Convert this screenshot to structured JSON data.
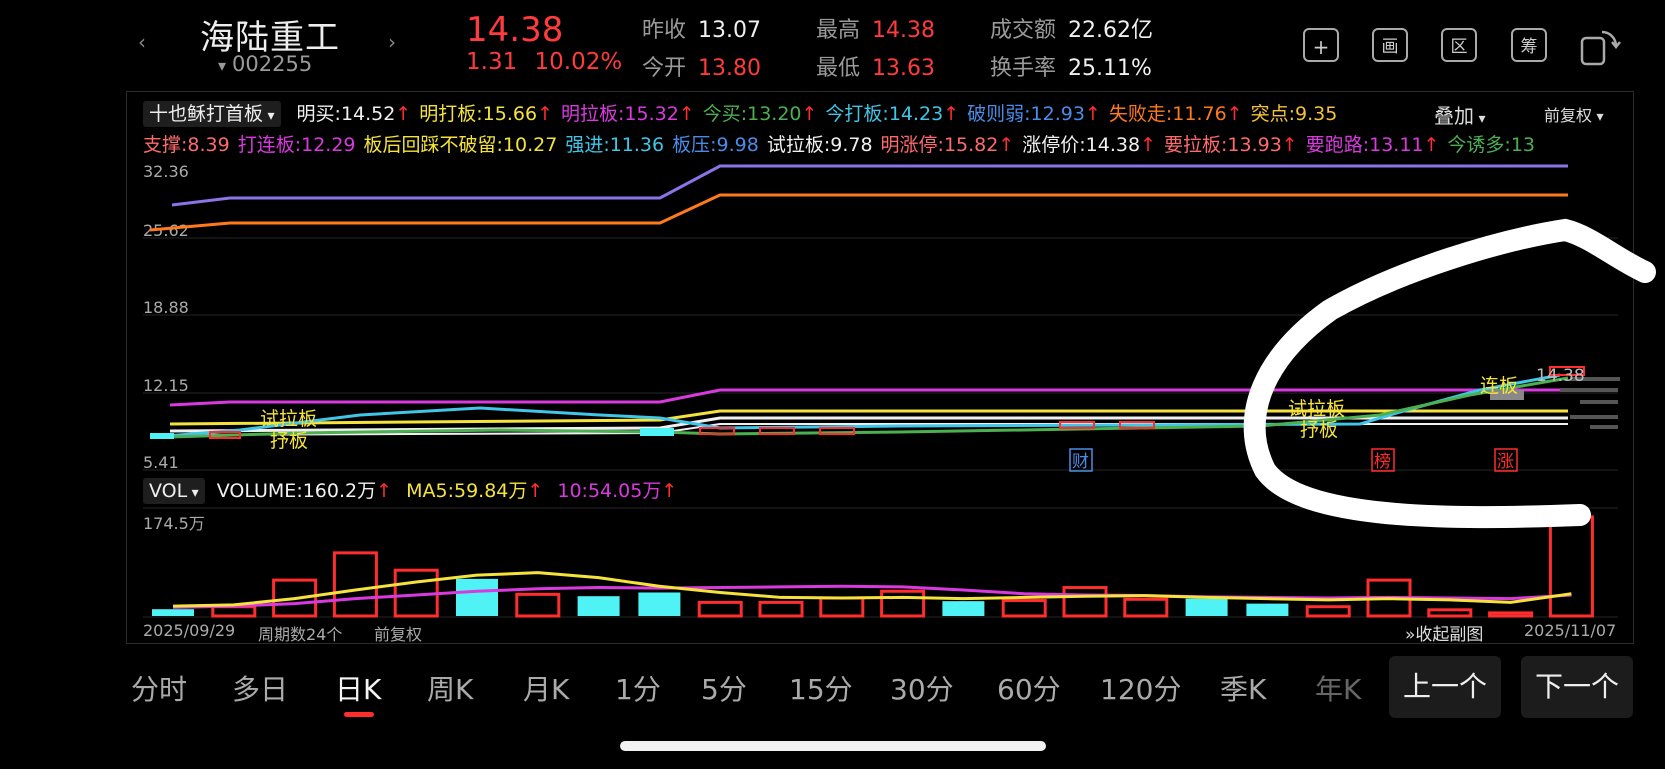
{
  "stock": {
    "name": "海陆重工",
    "code": "002255",
    "price": "14.38",
    "change": "1.31",
    "change_pct": "10.02%",
    "prev_close_label": "昨收",
    "prev_close": "13.07",
    "open_label": "今开",
    "open": "13.80",
    "high_label": "最高",
    "high": "14.38",
    "low_label": "最低",
    "low": "13.63",
    "turnover_label": "成交额",
    "turnover": "22.62亿",
    "turnover_rate_label": "换手率",
    "turnover_rate": "25.11%"
  },
  "toolbar": {
    "add_icon": "plus-icon",
    "draw_label": "画",
    "range_label": "区",
    "chips_label": "筹",
    "rotate_icon": "rotate-screen-icon"
  },
  "indicator": {
    "name": "十也稣打首板",
    "overlay_label": "叠加",
    "adjust_label": "前复权",
    "row1": [
      {
        "label": "明买:",
        "value": "14.52",
        "arrow": "↑",
        "color": "#f0f0f0"
      },
      {
        "label": "明打板:",
        "value": "15.66",
        "arrow": "↑",
        "color": "#f5e33c"
      },
      {
        "label": "明拉板:",
        "value": "15.32",
        "arrow": "↑",
        "color": "#d93adf"
      },
      {
        "label": "今买:",
        "value": "13.20",
        "arrow": "↑",
        "color": "#4caf50"
      },
      {
        "label": "今打板:",
        "value": "14.23",
        "arrow": "↑",
        "color": "#3fc6e8"
      },
      {
        "label": "破则弱:",
        "value": "12.93",
        "arrow": "↑",
        "color": "#4a8de8"
      },
      {
        "label": "失败走:",
        "value": "11.76",
        "arrow": "↑",
        "color": "#ff7a1a"
      },
      {
        "label": "突点:",
        "value": "9.35",
        "arrow": "",
        "color": "#f5c23c"
      }
    ],
    "row2": [
      {
        "label": "支撑:",
        "value": "8.39",
        "arrow": "",
        "color": "#ff6a6a"
      },
      {
        "label": "打连板:",
        "value": "12.29",
        "arrow": "",
        "color": "#d93adf"
      },
      {
        "label": "板后回踩不破留:",
        "value": "10.27",
        "arrow": "",
        "color": "#f5e33c"
      },
      {
        "label": "强进:",
        "value": "11.36",
        "arrow": "",
        "color": "#3fc6e8"
      },
      {
        "label": "板压:",
        "value": "9.98",
        "arrow": "",
        "color": "#4a8de8"
      },
      {
        "label": "试拉板:",
        "value": "9.78",
        "arrow": "",
        "color": "#f0f0f0"
      },
      {
        "label": "明涨停:",
        "value": "15.82",
        "arrow": "↑",
        "color": "#ff6a6a"
      },
      {
        "label": "涨停价:",
        "value": "14.38",
        "arrow": "↑",
        "color": "#f0f0f0"
      },
      {
        "label": "要拉板:",
        "value": "13.93",
        "arrow": "↑",
        "color": "#ff6a6a"
      },
      {
        "label": "要跑路:",
        "value": "13.11",
        "arrow": "↑",
        "color": "#d93adf"
      },
      {
        "label": "今诱多:",
        "value": "13",
        "arrow": "",
        "color": "#4caf50"
      }
    ]
  },
  "price_axis": [
    "32.36",
    "25.62",
    "18.88",
    "12.15",
    "5.41"
  ],
  "price_markers": {
    "try_pull_1": "试拉板",
    "hold_1": "抒板",
    "try_pull_2": "试拉板",
    "hold_2": "抒板",
    "continuous": "连板",
    "last_price": "14.38",
    "fin_badge": "财",
    "list_badge": "榜",
    "rise_badge": "涨"
  },
  "volume": {
    "selector": "VOL",
    "volume_label": "VOLUME:",
    "volume_value": "160.2万",
    "volume_arrow": "↑",
    "ma5_label": "MA5:",
    "ma5_value": "59.84万",
    "ma5_arrow": "↑",
    "ma10_label": "10:",
    "ma10_value": "54.05万",
    "ma10_arrow": "↑",
    "axis_max": "174.5万"
  },
  "footer": {
    "start_date": "2025/09/29",
    "period_count": "周期数24个",
    "adjust": "前复权",
    "collapse": "收起副图",
    "end_date": "2025/11/07"
  },
  "tabs": [
    "分时",
    "多日",
    "日K",
    "周K",
    "月K",
    "1分",
    "5分",
    "15分",
    "30分",
    "60分",
    "120分",
    "季K",
    "年K"
  ],
  "active_tab": "日K",
  "nav": {
    "prev": "上一个",
    "next": "下一个"
  },
  "colors": {
    "up": "#ff2d2d",
    "down": "#4ff3f5",
    "ma5": "#f5e33c",
    "ma10": "#d93adf"
  },
  "chart_data": {
    "type": "bar",
    "ylim": [
      0,
      174.5
    ],
    "series": [
      {
        "name": "VOLUME",
        "values": [
          11,
          15,
          58,
          102,
          74,
          60,
          35,
          32,
          38,
          22,
          22,
          29,
          40,
          24,
          25,
          46,
          27,
          28,
          20,
          15,
          58,
          10,
          5,
          160.2
        ],
        "direction": [
          "down",
          "up",
          "up",
          "up",
          "up",
          "down",
          "up",
          "down",
          "down",
          "up",
          "up",
          "up",
          "up",
          "down",
          "up",
          "up",
          "up",
          "down",
          "down",
          "up",
          "up",
          "up",
          "up",
          "up"
        ]
      },
      {
        "name": "MA5",
        "values": [
          16,
          18,
          28,
          42,
          55,
          66,
          70,
          62,
          48,
          38,
          30,
          29,
          30,
          28,
          30,
          32,
          33,
          30,
          28,
          26,
          28,
          26,
          22,
          36
        ]
      },
      {
        "name": "10",
        "values": [
          14,
          16,
          20,
          28,
          34,
          40,
          44,
          46,
          45,
          46,
          47,
          48,
          47,
          42,
          36,
          34,
          33,
          31,
          30,
          29,
          30,
          29,
          28,
          34
        ]
      }
    ]
  }
}
